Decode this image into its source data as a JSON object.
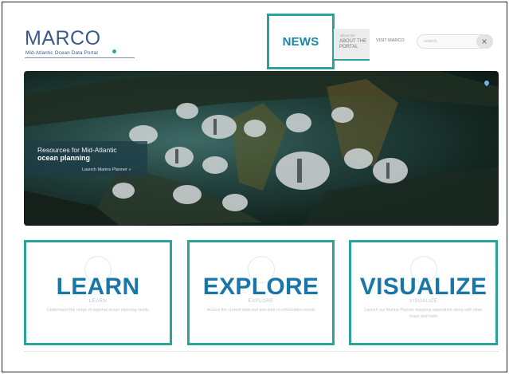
{
  "logo": {
    "title": "MARCO",
    "subtitle": "Mid-Atlantic Ocean Data Portal"
  },
  "nav": {
    "news": "NEWS",
    "about_small": "about the",
    "about": "ABOUT THE PORTAL",
    "visit": "VISIT MARCO"
  },
  "search": {
    "placeholder": "search",
    "clear": "×"
  },
  "hero": {
    "line1": "Resources for Mid-Atlantic",
    "line2": "ocean planning",
    "cta": "Launch Marine Planner »"
  },
  "cards": [
    {
      "heading": "LEARN",
      "sublabel": "LEARN",
      "desc": "Understand the range of regional ocean planning needs"
    },
    {
      "heading": "EXPLORE",
      "sublabel": "EXPLORE",
      "desc": "Access the current data and see data on information needs"
    },
    {
      "heading": "VISUALIZE",
      "sublabel": "VISUALIZE",
      "desc": "Launch our Marine Planner mapping application along with other maps and tools"
    }
  ],
  "colors": {
    "accent": "#2aa39a",
    "brand": "#3a5a8c",
    "heading": "#1877a8"
  }
}
